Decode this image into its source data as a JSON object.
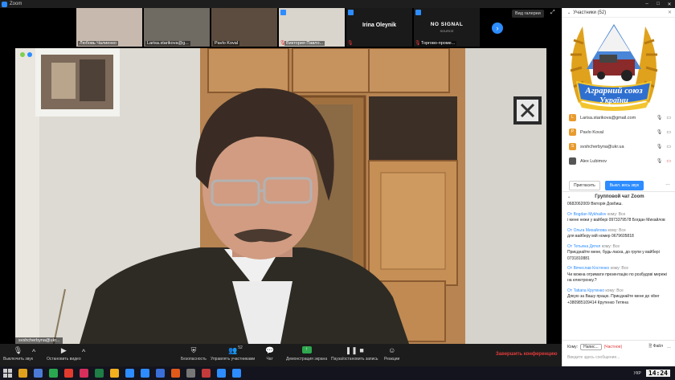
{
  "window": {
    "title": "Zoom",
    "controls": [
      "–",
      "□",
      "✕"
    ]
  },
  "thumbnails": [
    {
      "name": "Любовь Чалиенко",
      "muted": false,
      "bg": "#c7b9ae"
    },
    {
      "name": "Larisa.starikova@g...",
      "muted": false,
      "bg": "#6f6a62"
    },
    {
      "name": "Pavlo Koval",
      "muted": false,
      "bg": "#5b4c3f"
    },
    {
      "name": "Виктория Павло...",
      "muted": true,
      "bg": "#d9d4cc"
    },
    {
      "name": "Irina Oleynik",
      "muted": true,
      "textonly": true
    },
    {
      "name": "Торгово-проме...",
      "muted": true,
      "nosignal": "NO SIGNAL",
      "nosignal_sub": "SOURCE"
    }
  ],
  "gallery_button": "Вид галереи",
  "main_video": {
    "name": "svshcherbyna@ukr..."
  },
  "toolbar": {
    "mute": "Выключить звук",
    "stop_video": "Остановить видео",
    "security": "Безопасность",
    "participants": "Управлять участниками",
    "participants_count": "52",
    "chat": "Чат",
    "share": "Демонстрация экрана",
    "record": "Пауза/остановить запись",
    "reactions": "Реакции",
    "end": "Завершить конференцию"
  },
  "participants_panel": {
    "title": "Участники (52)",
    "items": [
      {
        "name": "Larisa.starikova@gmail.com",
        "initial": "L",
        "color": "#e89b2e",
        "cam_off": false
      },
      {
        "name": "Pavlo Koval",
        "initial": "P",
        "color": "#e89b2e",
        "cam_off": false
      },
      {
        "name": "svshcherbyna@ukr.ua",
        "initial": "S",
        "color": "#e89b2e",
        "cam_off": false
      },
      {
        "name": "Alex Lubimov",
        "initial": "",
        "color": "#555555",
        "cam_off": true
      }
    ],
    "invite": "Пригласить",
    "mute_all": "Выкл. весь звук"
  },
  "chat": {
    "title": "Групповой чат Zoom",
    "messages": [
      {
        "from": "",
        "to": "",
        "text": "0682062009 Вікторія Довбиш."
      },
      {
        "from": "От Bogdan Mykhailov",
        "to": "кому: Все",
        "text": "і мене нежи у вайбері 0973379578 Богдан Михайлов"
      },
      {
        "from": "От Ольга Михайлова",
        "to": "кому: Все",
        "text": "для вайберу мій номер 0679605818"
      },
      {
        "from": "От Тетьяна Дятел",
        "to": "кому: Все",
        "text": "Приєднайте мене, будь-ласка, до групи у вайбері 0731810881"
      },
      {
        "from": "От Вячеслав Костенко",
        "to": "кому: Все",
        "text": "Чи можна отримати презентацію по розбудові мережі на електронку.?"
      },
      {
        "from": "От Tatiana Крутенко",
        "to": "кому: Все",
        "text": "Дякую за Вашу працю. Приєднайте мене до viber +380985109414 Крутенко Тетяна"
      }
    ],
    "to_label": "Кому:",
    "to_value": "Напис...",
    "private": "(Частное)",
    "file": "Файл",
    "placeholder": "Введите здесь сообщение..."
  },
  "logo": {
    "line1": "Аграрний союз",
    "line2": "України"
  },
  "taskbar": {
    "lang": "УКР",
    "clock": "14:24",
    "apps": [
      "#e0a21d",
      "#4b7bd6",
      "#2aa84f",
      "#e23b2e",
      "#d62f5b",
      "#1e7e45",
      "#f2b01e",
      "#2d8cff",
      "#2d8cff",
      "#3a6fd8",
      "#e05a1a",
      "#777777",
      "#c43b3b",
      "#2d8cff",
      "#2d8cff"
    ]
  }
}
